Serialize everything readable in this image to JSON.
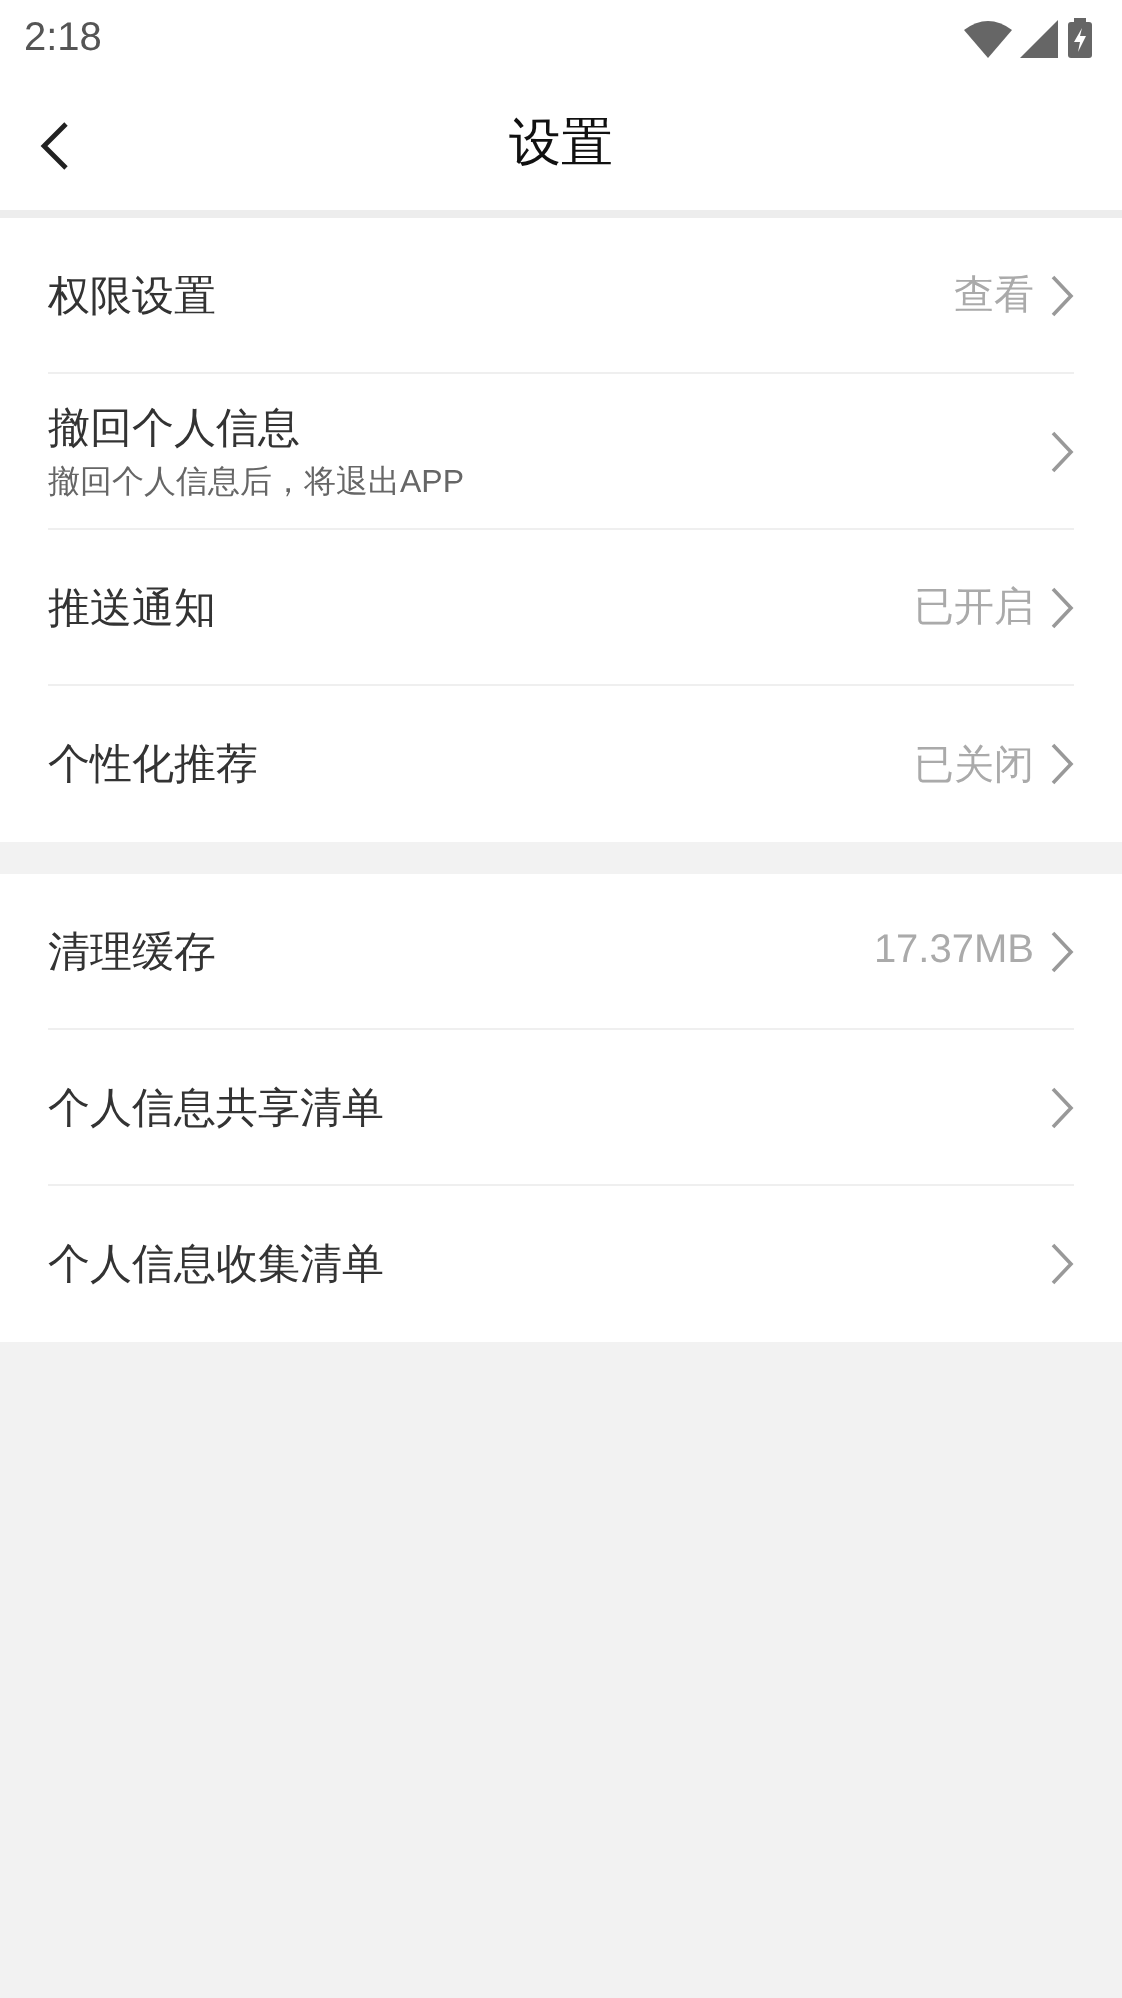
{
  "status_bar": {
    "time": "2:18"
  },
  "header": {
    "title": "设置"
  },
  "groups": [
    {
      "items": [
        {
          "label": "权限设置",
          "value": "查看"
        },
        {
          "label": "撤回个人信息",
          "subtitle": "撤回个人信息后，将退出APP"
        },
        {
          "label": "推送通知",
          "value": "已开启"
        },
        {
          "label": "个性化推荐",
          "value": "已关闭"
        }
      ]
    },
    {
      "items": [
        {
          "label": "清理缓存",
          "value": "17.37MB"
        },
        {
          "label": "个人信息共享清单"
        },
        {
          "label": "个人信息收集清单"
        }
      ]
    }
  ]
}
